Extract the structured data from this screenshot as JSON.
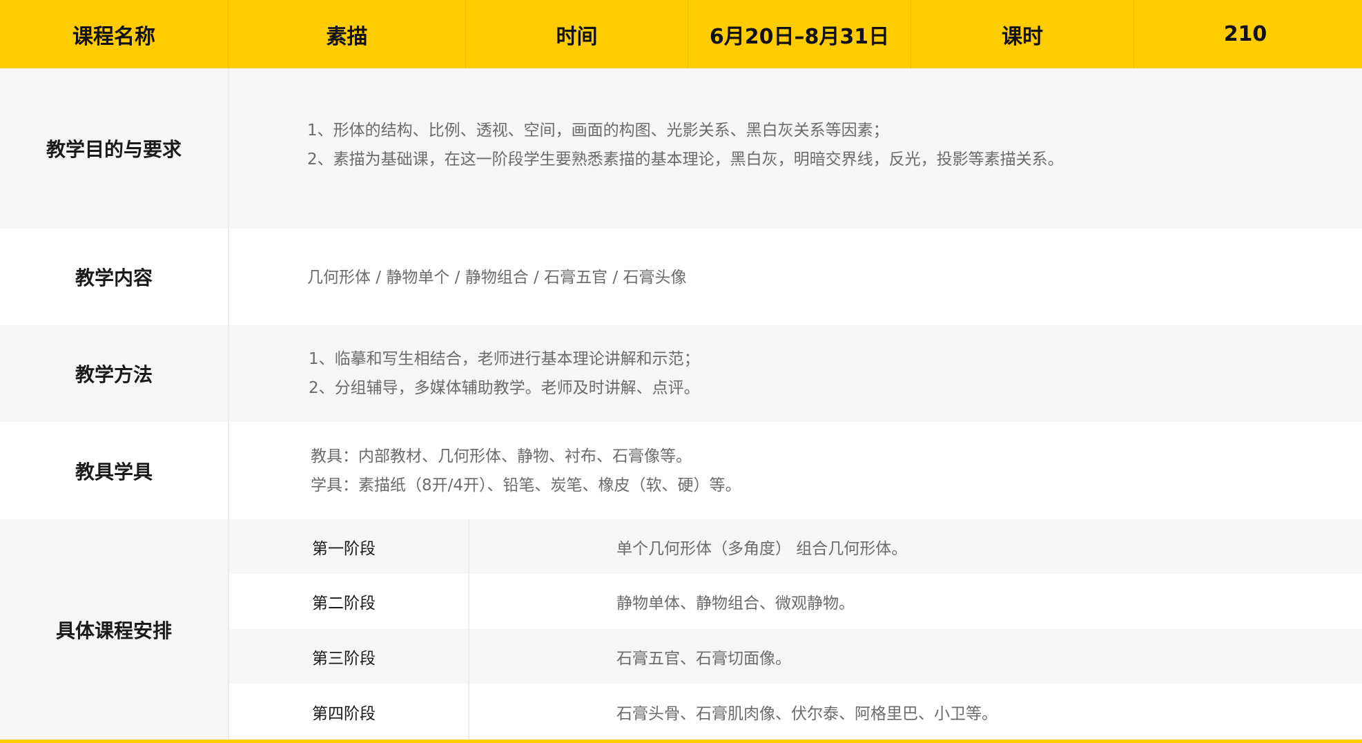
{
  "header": {
    "cells": [
      "课程名称",
      "素描",
      "时间",
      "6月20日–8月31日",
      "课时",
      "210"
    ]
  },
  "objectives": {
    "label": "教学目的与要求",
    "lines": [
      "1、形体的结构、比例、透视、空间，画面的构图、光影关系、黑白灰关系等因素；",
      "2、素描为基础课，在这一阶段学生要熟悉素描的基本理论，黑白灰，明暗交界线，反光，投影等素描关系。"
    ]
  },
  "content": {
    "label": "教学内容",
    "text": "几何形体 / 静物单个 / 静物组合 / 石膏五官 / 石膏头像"
  },
  "methods": {
    "label": "教学方法",
    "lines": [
      "1、临摹和写生相结合，老师进行基本理论讲解和示范；",
      "2、分组辅导，多媒体辅助教学。老师及时讲解、点评。"
    ]
  },
  "tools": {
    "label": "教具学具",
    "lines": [
      "教具：内部教材、几何形体、静物、衬布、石膏像等。",
      "学具：素描纸（8开/4开）、铅笔、炭笔、橡皮（软、硬）等。"
    ]
  },
  "schedule": {
    "label": "具体课程安排",
    "stages": [
      {
        "name": "第一阶段",
        "detail": "单个几何形体（多角度） 组合几何形体。"
      },
      {
        "name": "第二阶段",
        "detail": "静物单体、静物组合、微观静物。"
      },
      {
        "name": "第三阶段",
        "detail": "石膏五官、石膏切面像。"
      },
      {
        "name": "第四阶段",
        "detail": "石膏头骨、石膏肌肉像、伏尔泰、阿格里巴、小卫等。"
      }
    ]
  },
  "colors": {
    "header_bg": "#FFCC00",
    "row_gray": "#F6F6F6",
    "row_white": "#FFFFFF",
    "label_text": "#1a1a1a",
    "body_text": "#6b6b6b"
  }
}
